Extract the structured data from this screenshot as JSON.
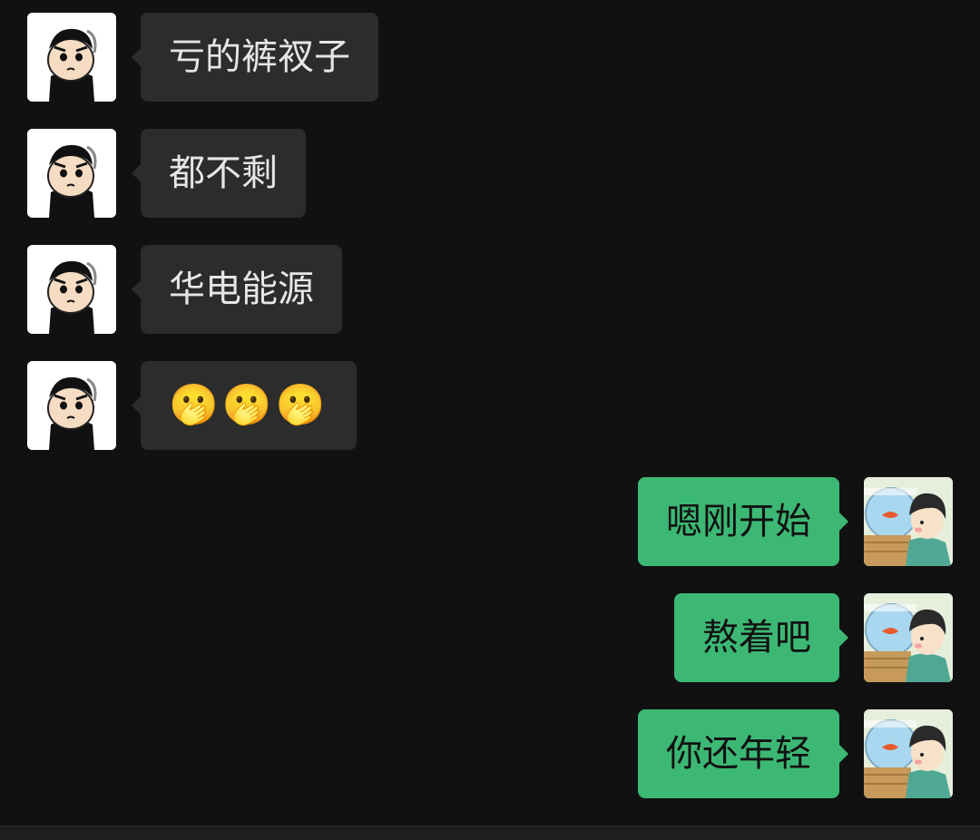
{
  "messages": [
    {
      "side": "left",
      "text": "亏的裤衩子"
    },
    {
      "side": "left",
      "text": "都不剩"
    },
    {
      "side": "left",
      "text": "华电能源"
    },
    {
      "side": "left",
      "text": "🫢🫢🫢"
    },
    {
      "side": "right",
      "text": "嗯刚开始"
    },
    {
      "side": "right",
      "text": "熬着吧"
    },
    {
      "side": "right",
      "text": "你还年轻"
    }
  ],
  "colors": {
    "background": "#111111",
    "incoming_bubble": "#2c2c2c",
    "outgoing_bubble": "#3cb874"
  },
  "icons": {
    "contact_avatar": "cartoon-boy-avatar-icon",
    "self_avatar": "fishbowl-boy-avatar-icon"
  }
}
